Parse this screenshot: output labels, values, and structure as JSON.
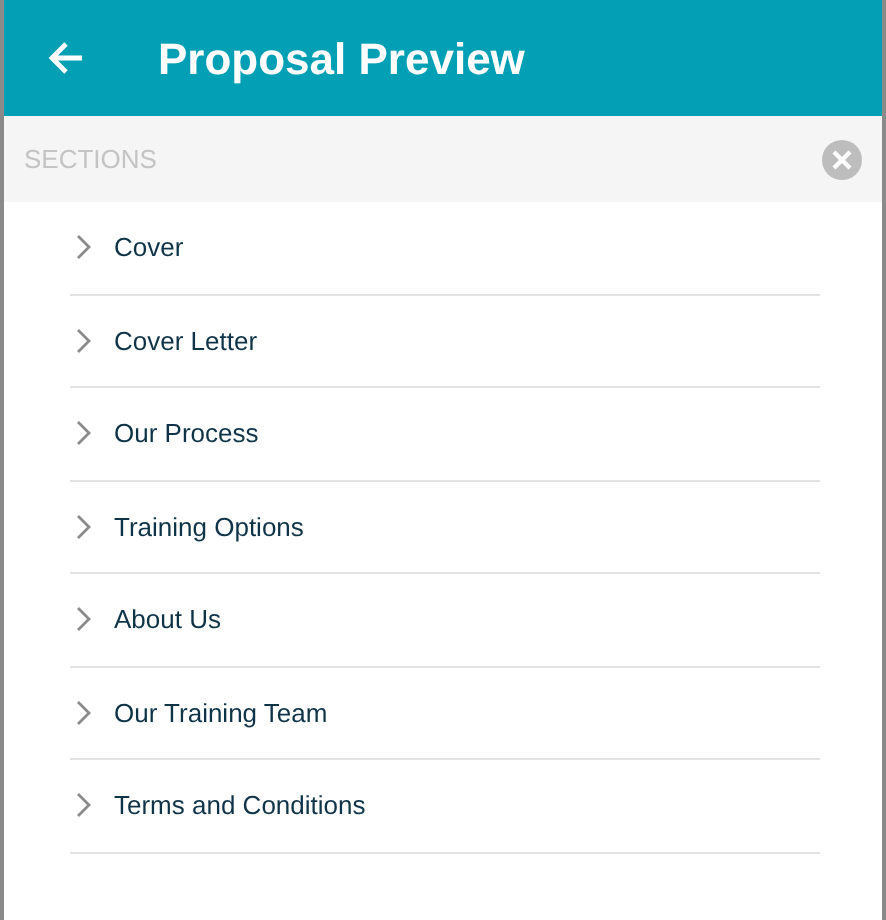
{
  "header": {
    "title": "Proposal Preview"
  },
  "sections": {
    "label": "SECTIONS",
    "items": [
      {
        "label": "Cover"
      },
      {
        "label": "Cover Letter"
      },
      {
        "label": "Our Process"
      },
      {
        "label": "Training Options"
      },
      {
        "label": "About Us"
      },
      {
        "label": "Our Training Team"
      },
      {
        "label": "Terms and Conditions"
      }
    ]
  }
}
